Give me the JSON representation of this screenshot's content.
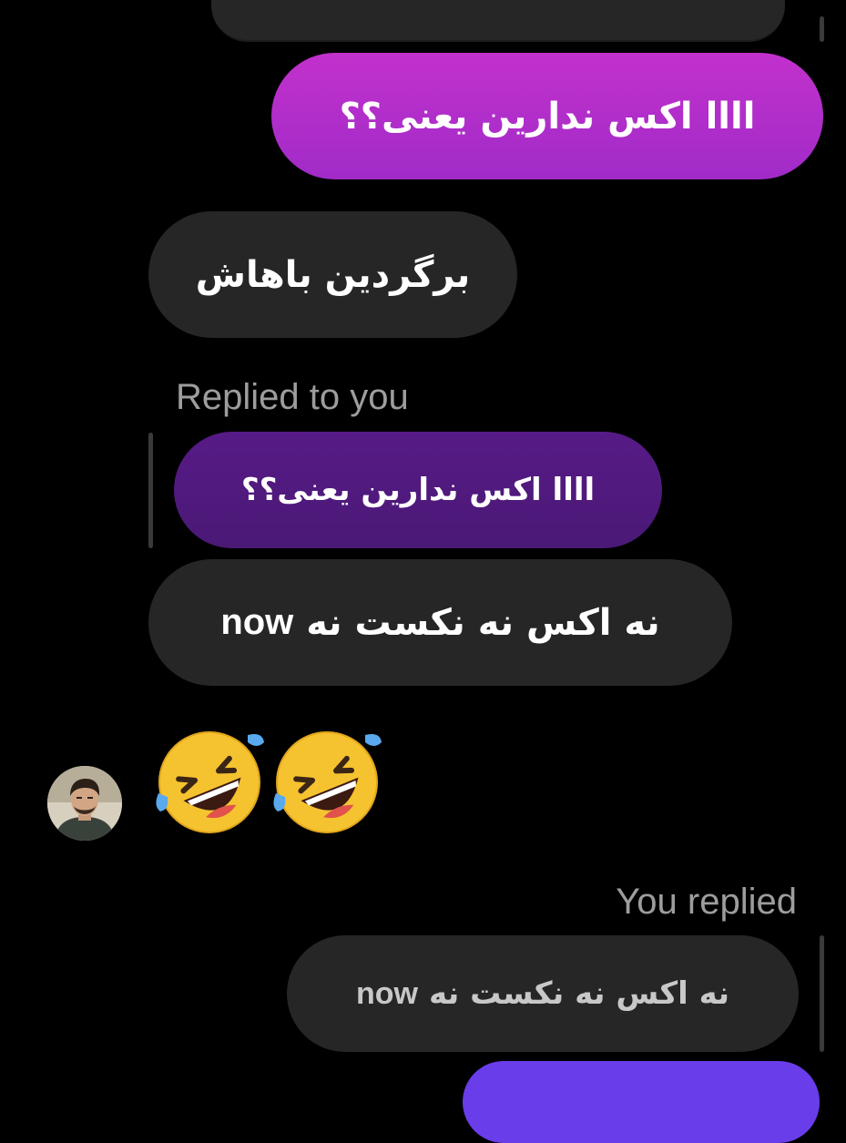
{
  "colors": {
    "background": "#000000",
    "sent_bubble": "#b92ecb",
    "received_bubble": "#262626",
    "quoted_sent_bubble": "#521982",
    "bottom_sent_bubble": "#6a3dea",
    "secondary_text": "#9d9d9d"
  },
  "messages": [
    {
      "from": "me",
      "text": "اااا اکس ندارین یعنی؟؟"
    },
    {
      "from": "them",
      "text": "برگردین باهاش"
    }
  ],
  "reply_from_them": {
    "label": "Replied to you",
    "quoted_text": "اااا اکس ندارین یعنی؟؟",
    "text_persian": "نه اکس نه نکست نه",
    "text_latin": "now"
  },
  "emoji_message": {
    "icons": [
      "rolling-on-floor-laughing-emoji",
      "rolling-on-floor-laughing-emoji"
    ]
  },
  "reply_from_me": {
    "label": "You replied",
    "quoted_text_persian": "نه اکس نه نکست نه",
    "quoted_text_latin": "now"
  }
}
